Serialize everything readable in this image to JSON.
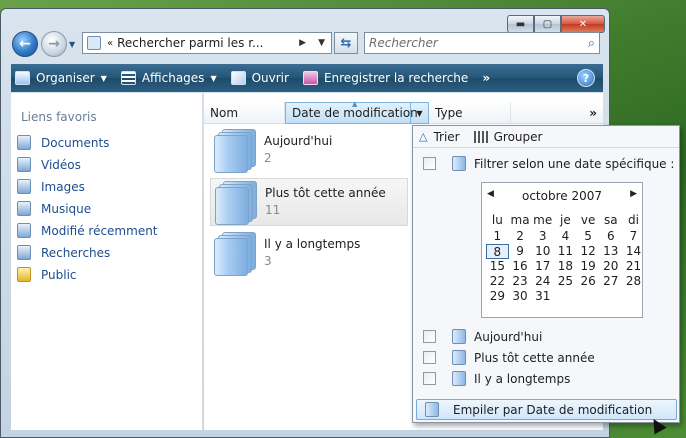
{
  "address": {
    "path": "Rechercher parmi les r...",
    "arrow": "▶"
  },
  "search": {
    "placeholder": "Rechercher"
  },
  "toolbar": {
    "organize": "Organiser",
    "views": "Affichages",
    "open": "Ouvrir",
    "save_search": "Enregistrer la recherche",
    "more": "»"
  },
  "sidebar": {
    "heading": "Liens favoris",
    "items": [
      {
        "label": "Documents"
      },
      {
        "label": "Vidéos"
      },
      {
        "label": "Images"
      },
      {
        "label": "Musique"
      },
      {
        "label": "Modifié récemment"
      },
      {
        "label": "Recherches"
      },
      {
        "label": "Public"
      }
    ]
  },
  "columns": {
    "name": "Nom",
    "date": "Date de modification",
    "type": "Type",
    "more": "»"
  },
  "groups": [
    {
      "name": "Aujourd'hui",
      "count": "2"
    },
    {
      "name": "Plus tôt cette année",
      "count": "11"
    },
    {
      "name": "Il y a longtemps",
      "count": "3"
    }
  ],
  "dropdown": {
    "sort": "Trier",
    "group": "Grouper",
    "filter_date": "Filtrer selon une date spécifique :",
    "calendar": {
      "month": "octobre 2007",
      "days_of_week": [
        "lu",
        "ma",
        "me",
        "je",
        "ve",
        "sa",
        "di"
      ],
      "weeks": [
        [
          "1",
          "2",
          "3",
          "4",
          "5",
          "6",
          "7"
        ],
        [
          "8",
          "9",
          "10",
          "11",
          "12",
          "13",
          "14"
        ],
        [
          "15",
          "16",
          "17",
          "18",
          "19",
          "20",
          "21"
        ],
        [
          "22",
          "23",
          "24",
          "25",
          "26",
          "27",
          "28"
        ],
        [
          "29",
          "30",
          "31",
          "",
          "",
          "",
          ""
        ]
      ],
      "selected_day": "8"
    },
    "filters": [
      {
        "label": "Aujourd'hui"
      },
      {
        "label": "Plus tôt cette année"
      },
      {
        "label": "Il y a longtemps"
      }
    ],
    "stack_by": "Empiler par Date de modification"
  },
  "colors": {
    "accent": "#2a6fbf",
    "link": "#1d4e8f",
    "toolbar": "#255676"
  }
}
